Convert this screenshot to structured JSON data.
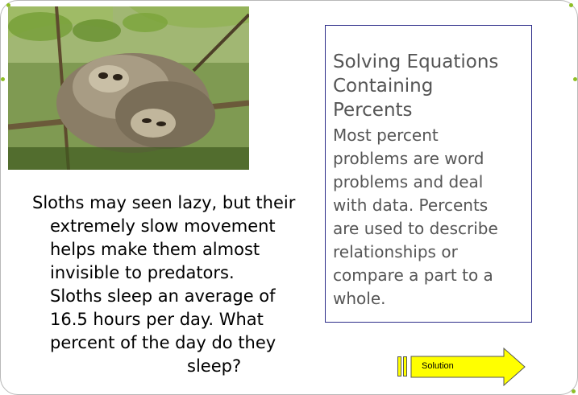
{
  "title": {
    "lines": [
      "Solving Equations",
      "Containing",
      "Percents"
    ]
  },
  "description": {
    "lines": [
      "Most percent",
      "problems are word",
      "problems and  deal",
      "with data.  Percents",
      "are used to describe",
      "relationships or",
      "compare a part to a",
      "whole."
    ]
  },
  "question": {
    "lines": [
      "Sloths may seen lazy, but their",
      "extremely slow movement",
      "helps make them almost",
      "invisible to predators.",
      "Sloths sleep an average of",
      "16.5 hours per day.  What",
      "percent of the day do they",
      "sleep?"
    ]
  },
  "solution_button": {
    "label": "Solution"
  },
  "colors": {
    "accent_dot": "#8fbf26",
    "box_border": "#2e2e8a",
    "arrow_fill": "#ffff00"
  }
}
